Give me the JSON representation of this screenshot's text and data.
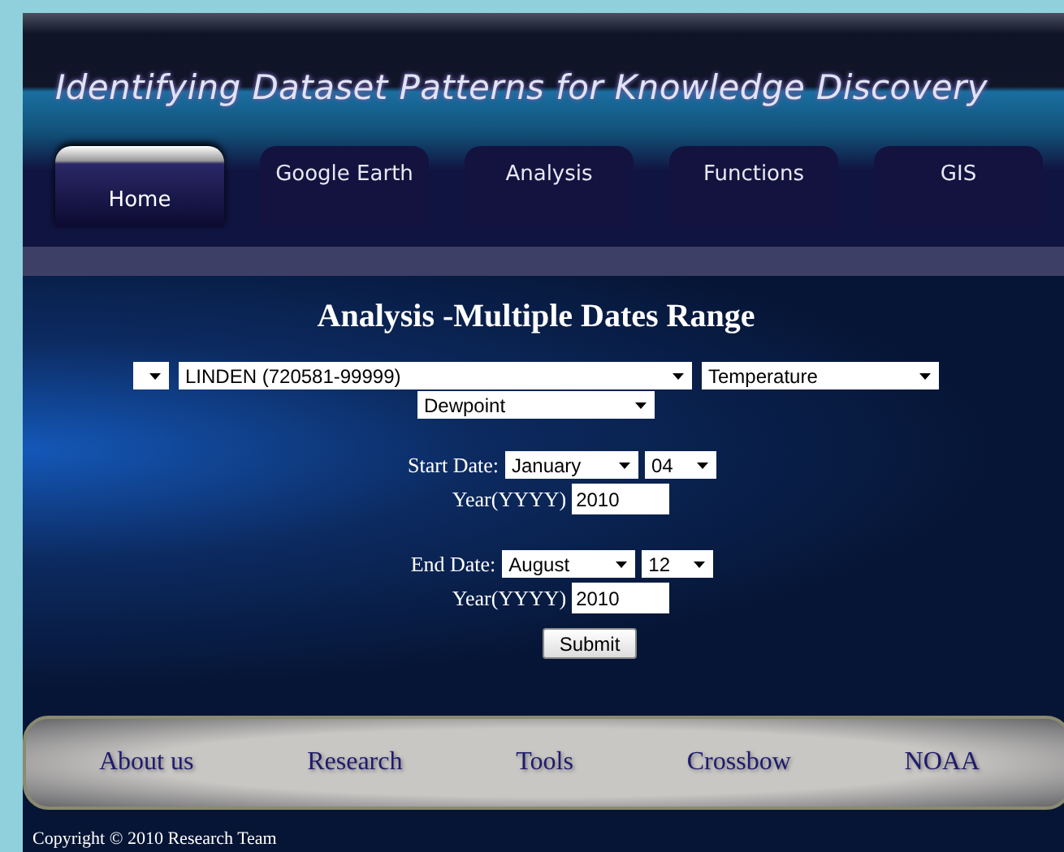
{
  "header": {
    "title": "Identifying Dataset Patterns for Knowledge Discovery"
  },
  "tabs": [
    {
      "label": "Home",
      "selected": true
    },
    {
      "label": "Google Earth",
      "selected": false
    },
    {
      "label": "Analysis",
      "selected": false
    },
    {
      "label": "Functions",
      "selected": false
    },
    {
      "label": "GIS",
      "selected": false
    }
  ],
  "form": {
    "heading": "Analysis -Multiple Dates Range",
    "station_row": [
      {
        "kind": "tiny"
      },
      {
        "kind": "wide",
        "value": "LINDEN (720581-99999)"
      },
      {
        "kind": "medium",
        "value": "Temperature"
      }
    ],
    "second_row": [
      {
        "kind": "medium",
        "value": "Dewpoint"
      }
    ],
    "start": {
      "label": "Start Date:",
      "month": "January",
      "day": "04",
      "year_label": "Year(YYYY)",
      "year": "2010"
    },
    "end": {
      "label": "End Date:",
      "month": "August",
      "day": "12",
      "year_label": "Year(YYYY)",
      "year": "2010"
    },
    "submit": "Submit"
  },
  "footer_links": [
    "About us",
    "Research",
    "Tools",
    "Crossbow",
    "NOAA"
  ],
  "copyright": "Copyright © 2010 Research Team"
}
